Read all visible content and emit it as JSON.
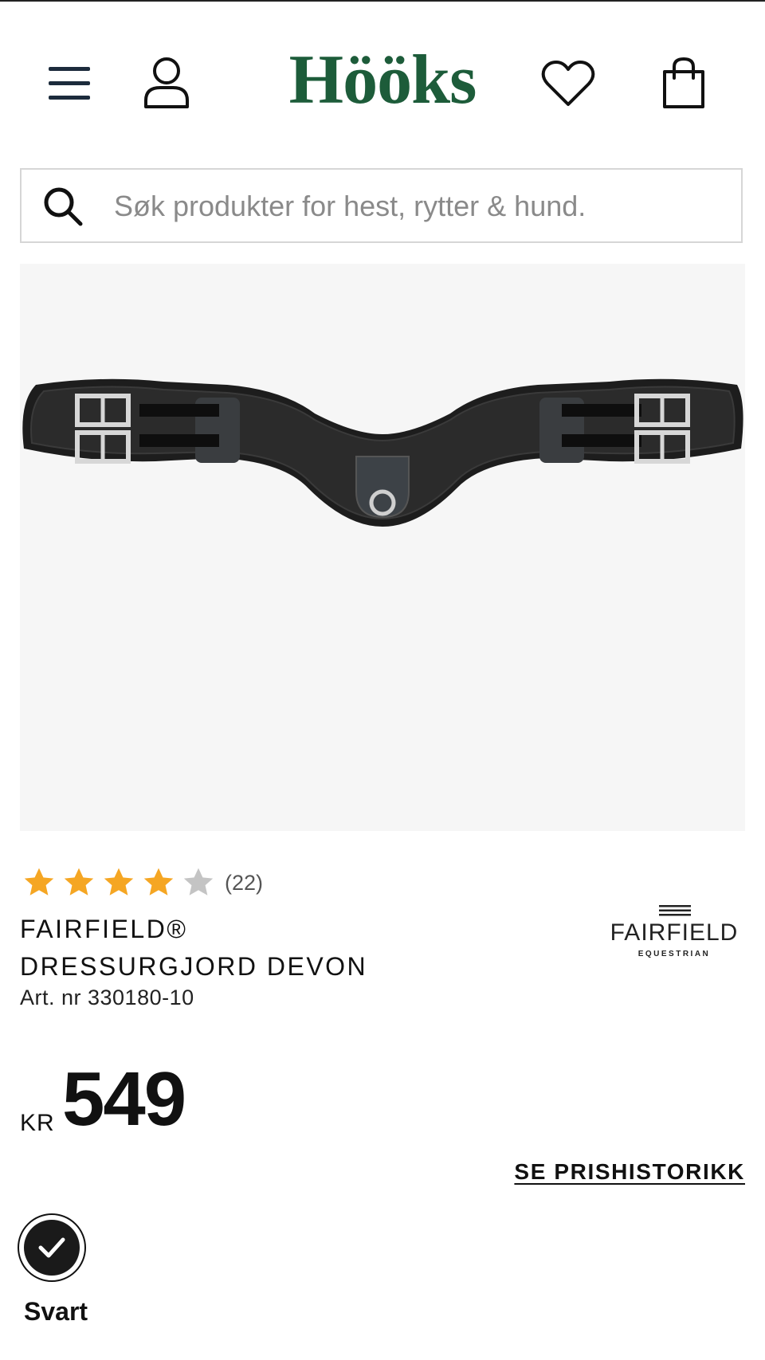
{
  "header": {
    "logo_text": "Hööks",
    "logo_color": "#1d5c3a"
  },
  "search": {
    "placeholder": "Søk produkter for hest, rytter & hund."
  },
  "product": {
    "rating": {
      "stars_filled": 4,
      "stars_total": 5,
      "review_count": "(22)"
    },
    "brand_line": "FAIRFIELD®",
    "name_line": "DRESSURGJORD DEVON",
    "art_nr": "Art. nr 330180-10",
    "brand_logo": {
      "name": "FAIRFIELD",
      "sub": "EQUESTRIAN"
    },
    "currency": "KR",
    "price": "549",
    "price_history_label": "SE PRISHISTORIKK",
    "selected_color": {
      "label": "Svart",
      "value": "#1a1a1a"
    }
  },
  "icons": [
    "menu-icon",
    "account-icon",
    "heart-icon",
    "bag-icon",
    "search-icon",
    "star-icon",
    "check-icon"
  ],
  "colors": {
    "star_filled": "#f5a623",
    "star_empty": "#c4c4c4",
    "image_bg": "#f6f6f6"
  }
}
